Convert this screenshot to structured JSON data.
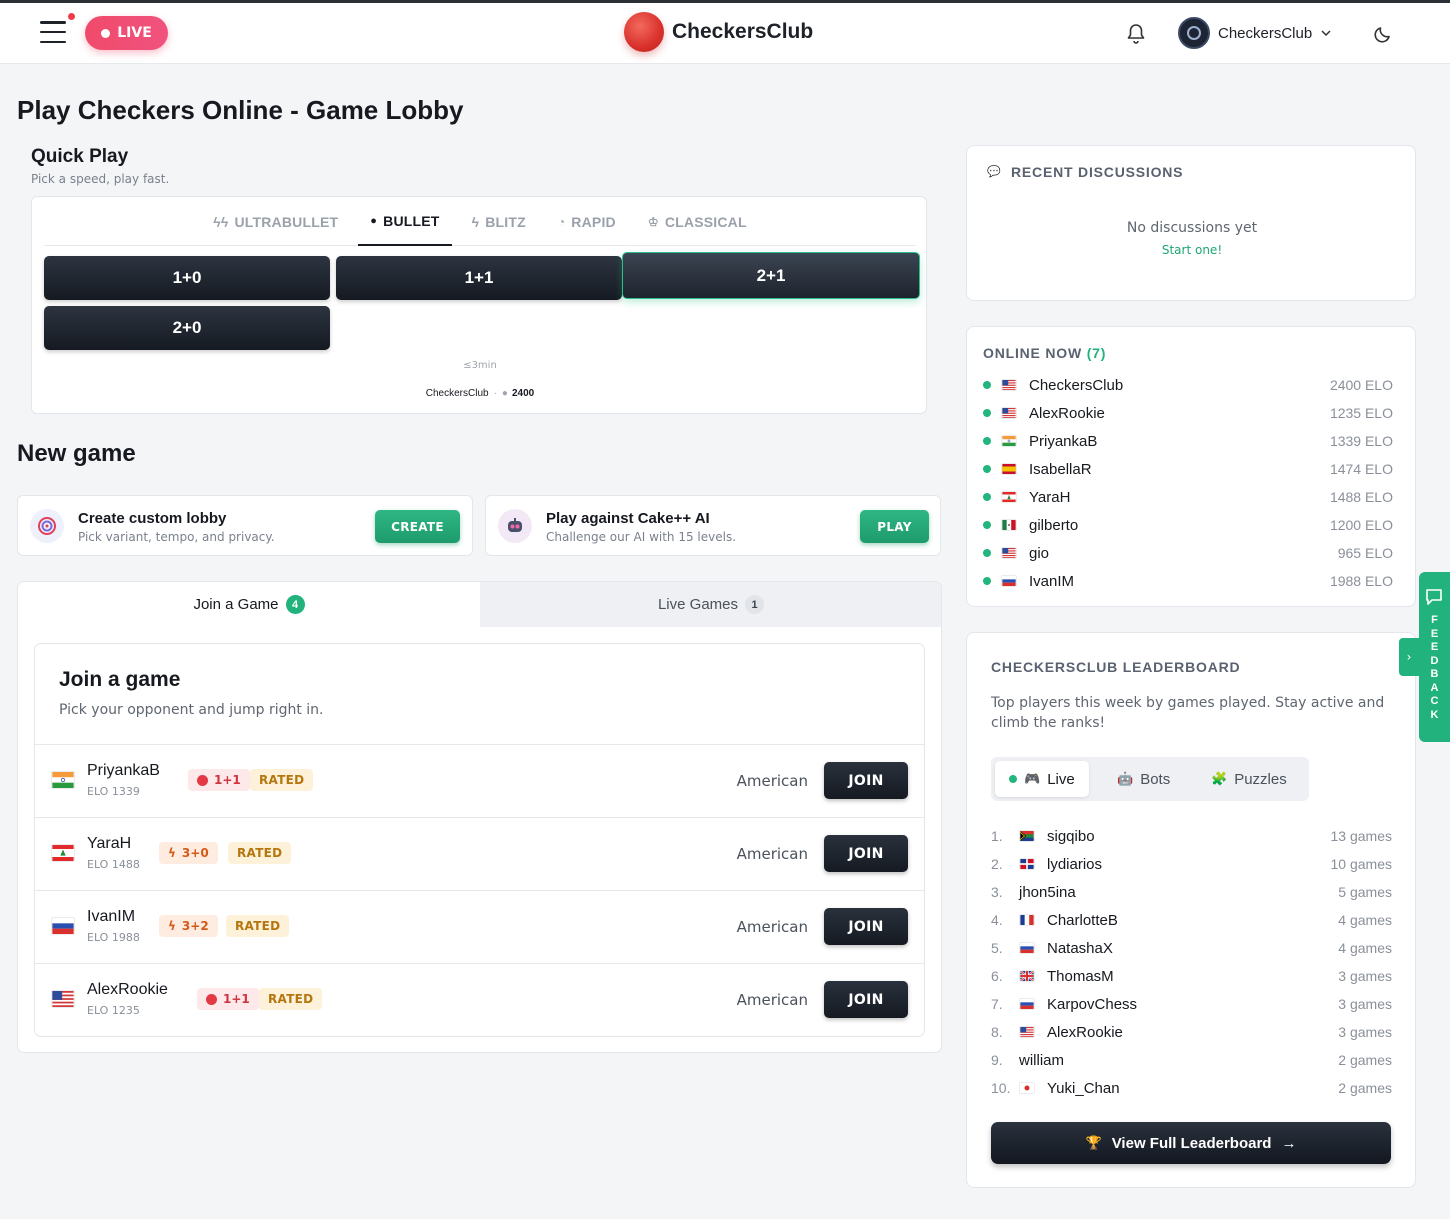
{
  "header": {
    "live_label": "LIVE",
    "brand": "CheckersClub",
    "username": "CheckersClub"
  },
  "page_title": "Play Checkers Online - Game Lobby",
  "quick_play": {
    "title": "Quick Play",
    "subtitle": "Pick a speed, play fast.",
    "tabs": [
      {
        "label": "ULTRABULLET",
        "icon": "double-bolt-icon"
      },
      {
        "label": "BULLET",
        "icon": "dot-icon"
      },
      {
        "label": "BLITZ",
        "icon": "bolt-icon"
      },
      {
        "label": "RAPID",
        "icon": "clock-icon"
      },
      {
        "label": "CLASSICAL",
        "icon": "crown-icon"
      }
    ],
    "active_tab": "BULLET",
    "time_controls": [
      "1+0",
      "1+1",
      "2+1",
      "2+0"
    ],
    "selected": "2+1",
    "range_label": "≤3min",
    "user_name": "CheckersClub",
    "user_elo": "2400"
  },
  "new_game": {
    "title": "New game",
    "custom": {
      "name": "Create custom lobby",
      "desc": "Pick variant, tempo, and privacy.",
      "button": "CREATE"
    },
    "ai": {
      "name": "Play against Cake++ AI",
      "desc": "Challenge our AI with 15 levels.",
      "button": "PLAY"
    }
  },
  "games_tabs": {
    "join": {
      "label": "Join a Game",
      "count": "4"
    },
    "live": {
      "label": "Live Games",
      "count": "1"
    }
  },
  "join_panel": {
    "title": "Join a game",
    "subtitle": "Pick your opponent and jump right in.",
    "rows": [
      {
        "name": "PriyankaB",
        "elo": "ELO 1339",
        "tc": "1+1",
        "speed": "bullet",
        "rated": "RATED",
        "variant": "American",
        "button": "JOIN",
        "flag": "india"
      },
      {
        "name": "YaraH",
        "elo": "ELO 1488",
        "tc": "3+0",
        "speed": "blitz",
        "rated": "RATED",
        "variant": "American",
        "button": "JOIN",
        "flag": "lebanon"
      },
      {
        "name": "IvanIM",
        "elo": "ELO 1988",
        "tc": "3+2",
        "speed": "blitz",
        "rated": "RATED",
        "variant": "American",
        "button": "JOIN",
        "flag": "russia"
      },
      {
        "name": "AlexRookie",
        "elo": "ELO 1235",
        "tc": "1+1",
        "speed": "bullet",
        "rated": "RATED",
        "variant": "American",
        "button": "JOIN",
        "flag": "usa"
      }
    ]
  },
  "recent_discussions": {
    "title": "RECENT DISCUSSIONS",
    "empty": "No discussions yet",
    "link": "Start one!"
  },
  "online_now": {
    "title": "ONLINE NOW",
    "count": "(7)",
    "players": [
      {
        "name": "CheckersClub",
        "elo": "2400 ELO",
        "flag": "usa"
      },
      {
        "name": "AlexRookie",
        "elo": "1235 ELO",
        "flag": "usa"
      },
      {
        "name": "PriyankaB",
        "elo": "1339 ELO",
        "flag": "india"
      },
      {
        "name": "IsabellaR",
        "elo": "1474 ELO",
        "flag": "spain"
      },
      {
        "name": "YaraH",
        "elo": "1488 ELO",
        "flag": "lebanon"
      },
      {
        "name": "gilberto",
        "elo": "1200 ELO",
        "flag": "mexico"
      },
      {
        "name": "gio",
        "elo": "965 ELO",
        "flag": "usa"
      },
      {
        "name": "IvanIM",
        "elo": "1988 ELO",
        "flag": "russia"
      }
    ]
  },
  "leaderboard": {
    "title": "CHECKERSCLUB LEADERBOARD",
    "desc": "Top players this week by games played. Stay active and climb the ranks!",
    "tabs": [
      "Live",
      "Bots",
      "Puzzles"
    ],
    "active_tab": "Live",
    "rows": [
      {
        "rank": "1.",
        "name": "sigqibo",
        "games": "13 games",
        "flag": "southafrica"
      },
      {
        "rank": "2.",
        "name": "lydiarios",
        "games": "10 games",
        "flag": "dominican"
      },
      {
        "rank": "3.",
        "name": "jhon5ina",
        "games": "5 games",
        "flag": ""
      },
      {
        "rank": "4.",
        "name": "CharlotteB",
        "games": "4 games",
        "flag": "france"
      },
      {
        "rank": "5.",
        "name": "NatashaX",
        "games": "4 games",
        "flag": "russia"
      },
      {
        "rank": "6.",
        "name": "ThomasM",
        "games": "3 games",
        "flag": "uk"
      },
      {
        "rank": "7.",
        "name": "KarpovChess",
        "games": "3 games",
        "flag": "russia"
      },
      {
        "rank": "8.",
        "name": "AlexRookie",
        "games": "3 games",
        "flag": "usa"
      },
      {
        "rank": "9.",
        "name": "william",
        "games": "2 games",
        "flag": ""
      },
      {
        "rank": "10.",
        "name": "Yuki_Chan",
        "games": "2 games",
        "flag": "japan"
      }
    ],
    "button": "View Full Leaderboard"
  },
  "feedback": {
    "letters": [
      "F",
      "E",
      "E",
      "D",
      "B",
      "A",
      "C",
      "K"
    ]
  },
  "colors": {
    "accent": "#21b27d",
    "live": "#f04a6a",
    "dark_button": "#151a22"
  }
}
